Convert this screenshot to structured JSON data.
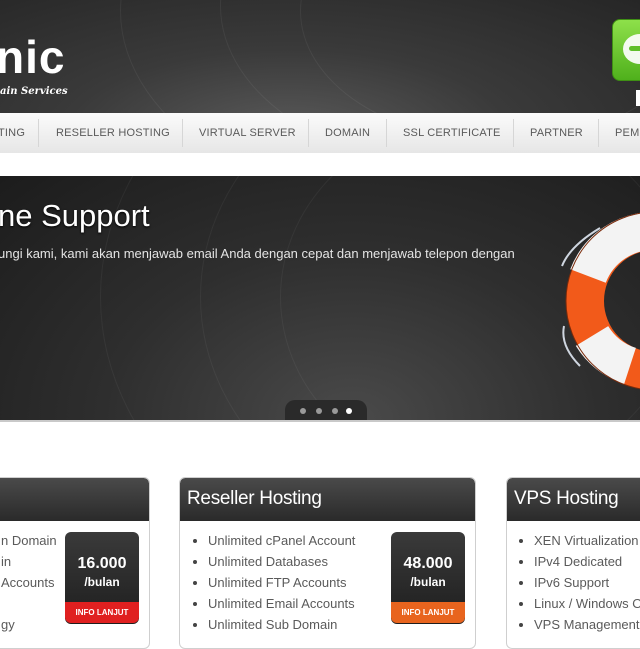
{
  "header": {
    "logo_text": "nic",
    "logo_subtitle": "ain Services"
  },
  "nav": {
    "items": [
      {
        "label": "TING"
      },
      {
        "label": "RESELLER HOSTING"
      },
      {
        "label": "VIRTUAL SERVER"
      },
      {
        "label": "DOMAIN"
      },
      {
        "label": "SSL CERTIFICATE"
      },
      {
        "label": "PARTNER"
      },
      {
        "label": "PEMI"
      }
    ]
  },
  "slider": {
    "title": "ne Support",
    "text": "ungi kami, kami akan menjawab email Anda dengan cepat dan menjawab telepon dengan",
    "active_dot": 4,
    "dot_count": 4
  },
  "boxes": [
    {
      "title": "",
      "items": [
        "n Domain",
        "in",
        "Accounts",
        "",
        "gy"
      ],
      "price": "16.000",
      "unit": "/bulan",
      "button": "INFO LANJUT",
      "button_color": "#e02020"
    },
    {
      "title": "Reseller Hosting",
      "items": [
        "Unlimited cPanel Account",
        "Unlimited Databases",
        "Unlimited FTP Accounts",
        "Unlimited Email Accounts",
        "Unlimited Sub Domain"
      ],
      "price": "48.000",
      "unit": "/bulan",
      "button": "INFO LANJUT",
      "button_color": "#e8641e"
    },
    {
      "title": "VPS Hosting",
      "items": [
        "XEN Virtualization",
        "IPv4 Dedicated",
        "IPv6 Support",
        "Linux / Windows O",
        "VPS Management"
      ]
    }
  ],
  "colors": {
    "badge_green": "#6fcf2c",
    "buoy_orange": "#f25a1a"
  }
}
